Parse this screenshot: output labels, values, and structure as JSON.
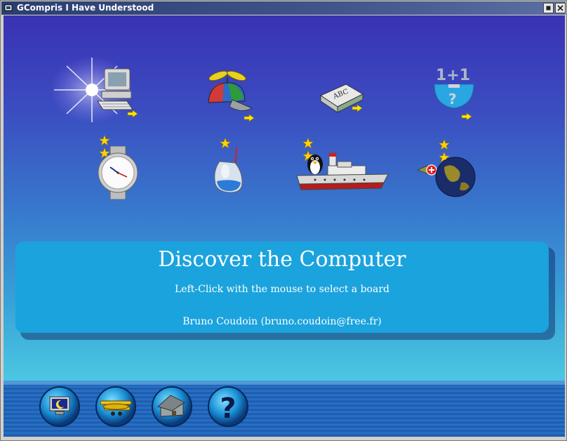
{
  "window": {
    "title": "GCompris I Have Understood",
    "app_icon": "gcompris-app-icon",
    "buttons": [
      "maximize-icon",
      "close-icon"
    ]
  },
  "boards": [
    {
      "name": "computer-board",
      "icon": "computer-icon",
      "has_submenu": true
    },
    {
      "name": "puzzle-board",
      "icon": "propeller-hat-icon",
      "has_submenu": true
    },
    {
      "name": "reading-board",
      "icon": "abc-book-icon",
      "has_submenu": true
    },
    {
      "name": "math-board",
      "icon": "math-1plus1-icon",
      "has_submenu": true
    },
    {
      "name": "clock-board",
      "icon": "watch-icon",
      "stars": 2
    },
    {
      "name": "chemistry-board",
      "icon": "flask-icon",
      "stars": 1
    },
    {
      "name": "boat-board",
      "icon": "tux-ship-icon",
      "stars": 2
    },
    {
      "name": "geography-board",
      "icon": "globe-icon",
      "stars": 2
    }
  ],
  "info": {
    "title": "Discover the Computer",
    "instruction": "Left-Click with the mouse to select a board",
    "author": "Bruno Coudoin (bruno.coudoin@free.fr)"
  },
  "controls": [
    {
      "name": "config-button",
      "icon": "monitor-moon-icon"
    },
    {
      "name": "about-button",
      "icon": "airplane-icon"
    },
    {
      "name": "home-button",
      "icon": "house-icon"
    },
    {
      "name": "help-button",
      "icon": "question-mark-icon"
    }
  ],
  "colors": {
    "info_panel": "#1ba3dd",
    "titlebar": "#2a3e70",
    "star": "#ffd400",
    "arrow": "#ffe600"
  }
}
